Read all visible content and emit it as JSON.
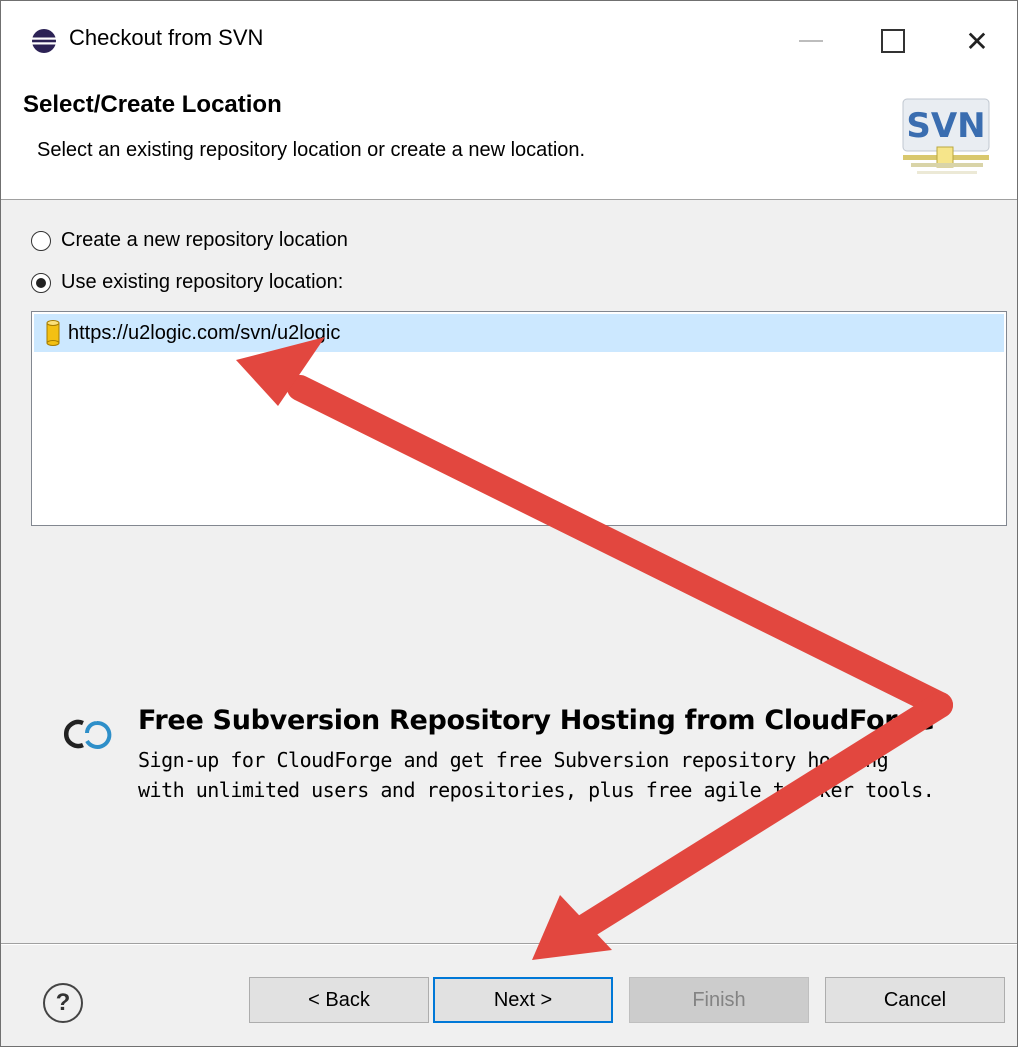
{
  "window": {
    "title": "Checkout from SVN",
    "icon": "eclipse-icon",
    "controls": [
      "minimize-icon",
      "maximize-icon",
      "close-icon"
    ],
    "close_glyph": "✕"
  },
  "header": {
    "title": "Select/Create Location",
    "description": "Select an existing repository location or create a new location.",
    "logo_text": "SVN"
  },
  "options": {
    "create_label": "Create a new repository location",
    "existing_label": "Use existing repository location:",
    "selected": "existing"
  },
  "repositories": [
    {
      "url": "https://u2logic.com/svn/u2logic",
      "icon": "repository-icon",
      "selected": true
    }
  ],
  "promo": {
    "icon": "cloudforge-icon",
    "title": "Free Subversion Repository Hosting from CloudForge",
    "line1": "Sign-up for CloudForge and get free Subversion repository hosting",
    "line2": "with unlimited users and repositories, plus free agile tracker tools."
  },
  "footer": {
    "help_glyph": "?",
    "back_label": "< Back",
    "next_label": "Next >",
    "finish_label": "Finish",
    "cancel_label": "Cancel"
  },
  "annotation": {
    "color": "#e2473f"
  }
}
